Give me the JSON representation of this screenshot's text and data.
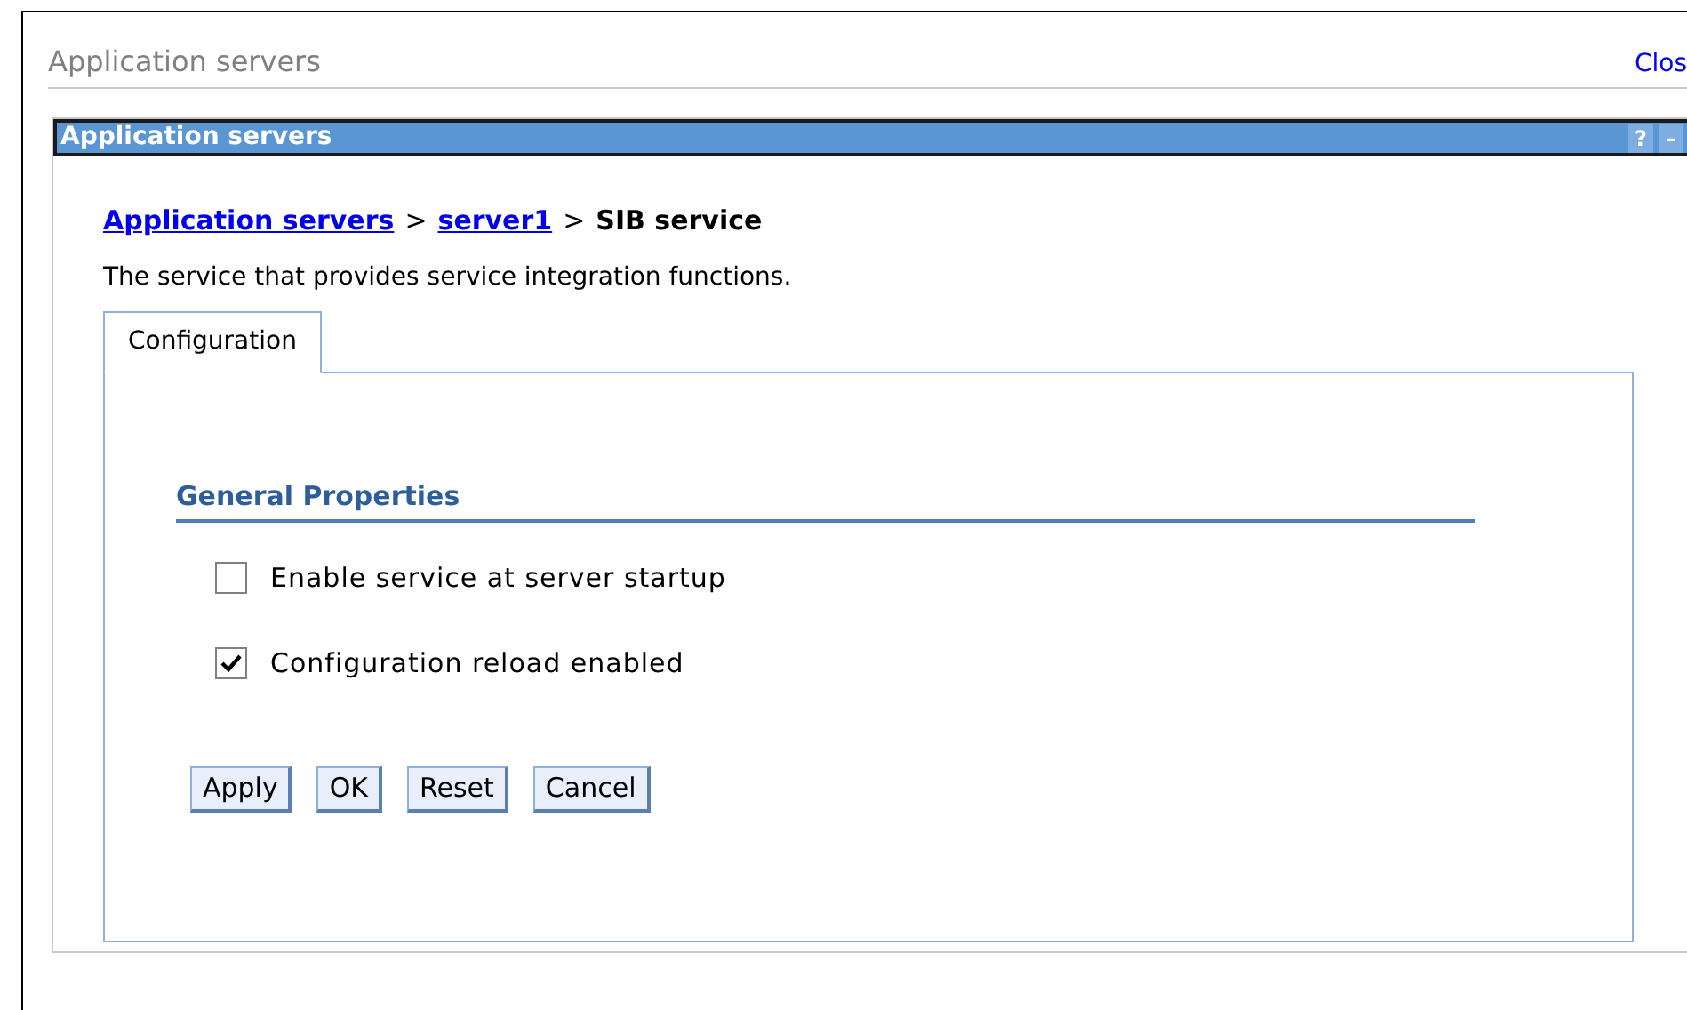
{
  "page_title": "Application servers",
  "close_link": "Clos",
  "panel": {
    "title": "Application servers",
    "help": "?",
    "minimize": "–"
  },
  "breadcrumb": [
    {
      "label": "Application servers",
      "kind": "link"
    },
    {
      "label": "server1",
      "kind": "link"
    },
    {
      "label": "SIB service",
      "kind": "current"
    }
  ],
  "breadcrumb_separator": ">",
  "description": "The service that provides service integration functions.",
  "tabs": [
    {
      "label": "Configuration",
      "selected": true
    }
  ],
  "section_title": "General Properties",
  "options": [
    {
      "label": "Enable service at server startup",
      "checked": false
    },
    {
      "label": "Configuration reload enabled",
      "checked": true
    }
  ],
  "buttons": [
    "Apply",
    "OK",
    "Reset",
    "Cancel"
  ]
}
